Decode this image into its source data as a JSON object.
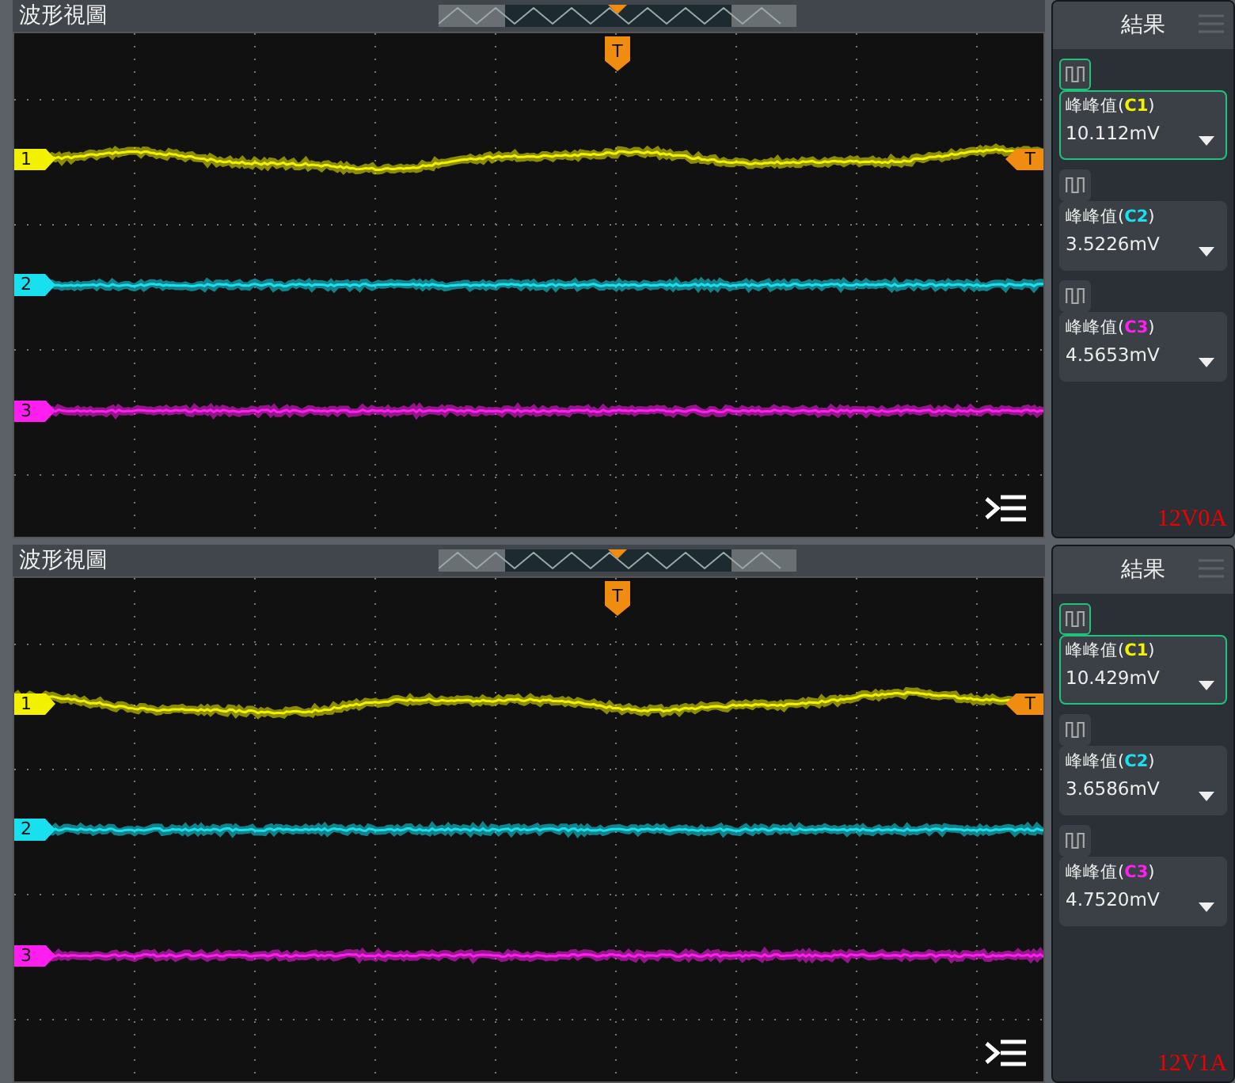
{
  "panels": [
    {
      "title": "波形視圖",
      "trigger_marker": "T",
      "trigger_level_marker": "T",
      "channels": [
        {
          "label": "1",
          "color": "#f2f200"
        },
        {
          "label": "2",
          "color": "#18e0ee"
        },
        {
          "label": "3",
          "color": "#ff1ef0"
        }
      ],
      "results": {
        "title": "結果",
        "measurements": [
          {
            "label_prefix": "峰峰值(",
            "channel": "C1",
            "label_suffix": ")",
            "color": "#f2f200",
            "value": "10.112mV",
            "selected": true
          },
          {
            "label_prefix": "峰峰值(",
            "channel": "C2",
            "label_suffix": ")",
            "color": "#18e0ee",
            "value": "3.5226mV",
            "selected": false
          },
          {
            "label_prefix": "峰峰值(",
            "channel": "C3",
            "label_suffix": ")",
            "color": "#ff1ef0",
            "value": "4.5653mV",
            "selected": false
          }
        ],
        "annotation": "12V0A"
      }
    },
    {
      "title": "波形視圖",
      "trigger_marker": "T",
      "trigger_level_marker": "T",
      "channels": [
        {
          "label": "1",
          "color": "#f2f200"
        },
        {
          "label": "2",
          "color": "#18e0ee"
        },
        {
          "label": "3",
          "color": "#ff1ef0"
        }
      ],
      "results": {
        "title": "結果",
        "measurements": [
          {
            "label_prefix": "峰峰值(",
            "channel": "C1",
            "label_suffix": ")",
            "color": "#f2f200",
            "value": "10.429mV",
            "selected": true
          },
          {
            "label_prefix": "峰峰值(",
            "channel": "C2",
            "label_suffix": ")",
            "color": "#18e0ee",
            "value": "3.6586mV",
            "selected": false
          },
          {
            "label_prefix": "峰峰值(",
            "channel": "C3",
            "label_suffix": ")",
            "color": "#ff1ef0",
            "value": "4.7520mV",
            "selected": false
          }
        ],
        "annotation": "12V1A"
      }
    }
  ]
}
